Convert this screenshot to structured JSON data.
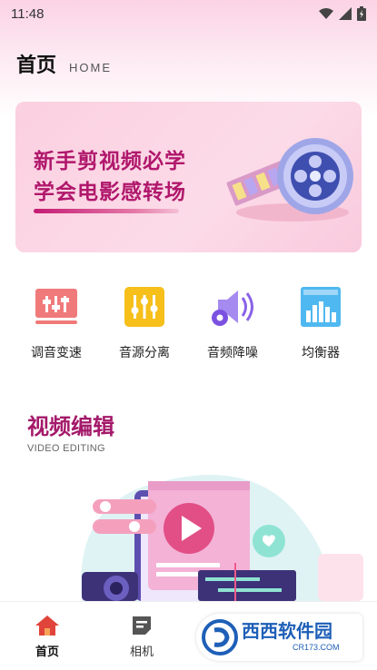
{
  "status_bar": {
    "time": "11:48"
  },
  "header": {
    "title": "首页",
    "subtitle": "HOME"
  },
  "banner": {
    "line1": "新手剪视频必学",
    "line2": "学会电影感转场"
  },
  "tools": [
    {
      "label": "调音变速",
      "icon": "sliders-icon",
      "color": "#f07a7a"
    },
    {
      "label": "音源分离",
      "icon": "equalizer-icon",
      "color": "#f6bf1a"
    },
    {
      "label": "音频降噪",
      "icon": "speaker-gear-icon",
      "color": "#8a63e8"
    },
    {
      "label": "均衡器",
      "icon": "bar-chart-icon",
      "color": "#4fb8f0"
    }
  ],
  "section": {
    "title": "视频编辑",
    "subtitle": "VIDEO EDITING"
  },
  "bottom_nav": [
    {
      "label": "首页",
      "icon": "home-icon",
      "active": true
    },
    {
      "label": "相机",
      "icon": "document-icon",
      "active": false
    },
    {
      "label": "",
      "icon": "list-icon",
      "active": false
    },
    {
      "label": "",
      "icon": "profile-icon",
      "active": false
    }
  ],
  "watermark": {
    "text": "西西软件园",
    "sub": "CR173.COM"
  },
  "colors": {
    "accent": "#a4196a",
    "nav_active": "#e0443a"
  }
}
